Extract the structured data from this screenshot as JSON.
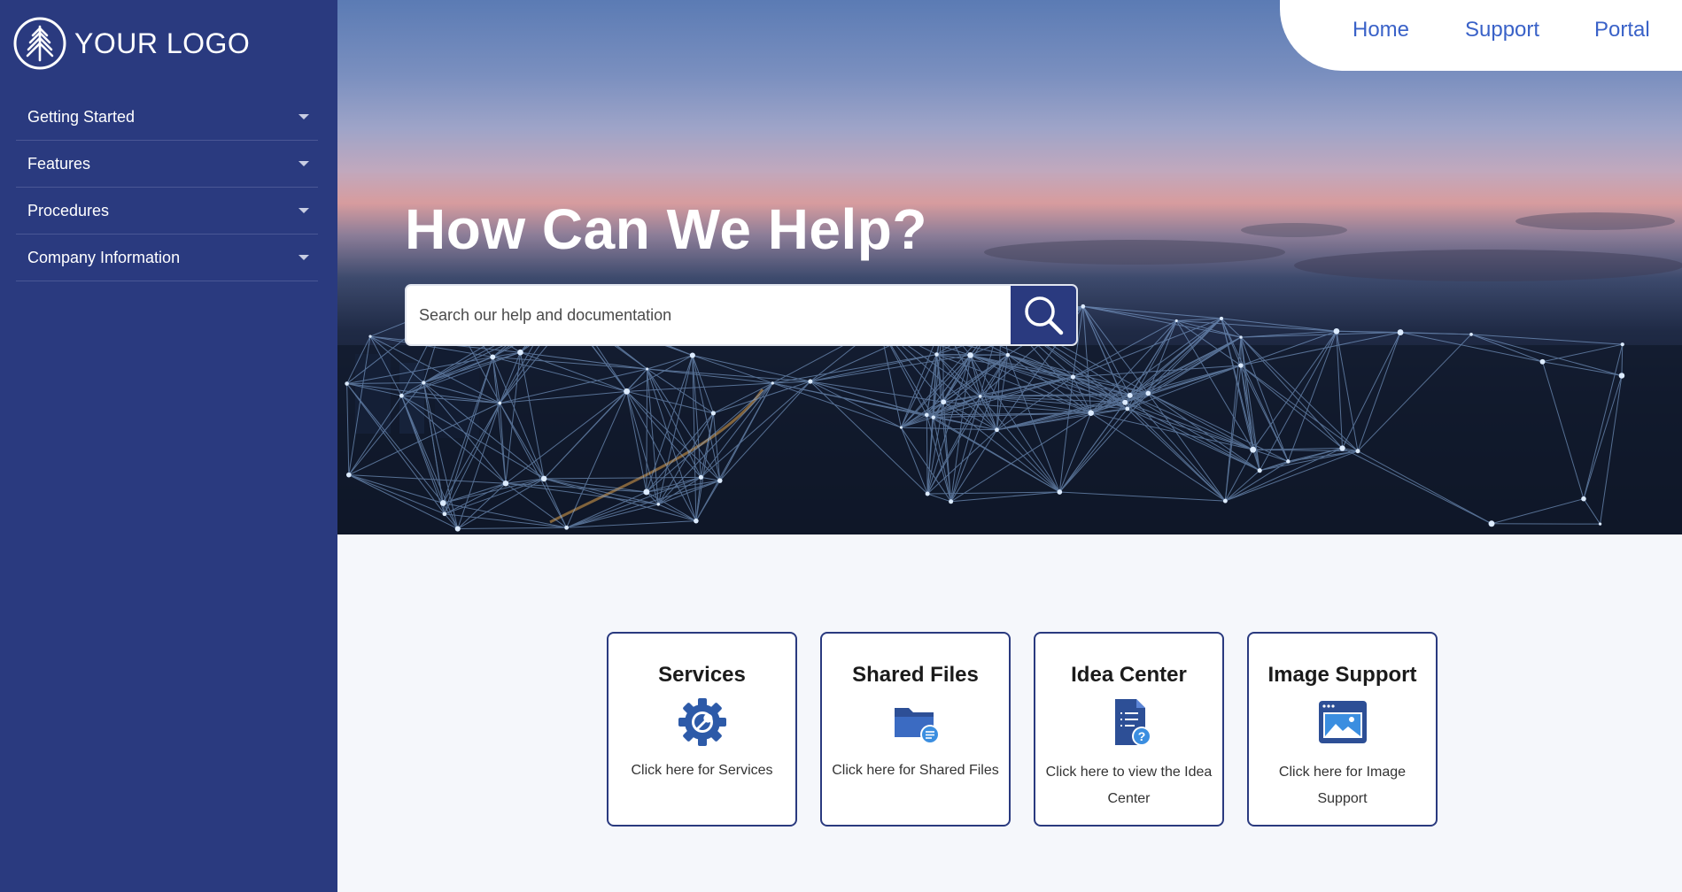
{
  "brand": {
    "logo_text": "YOUR LOGO"
  },
  "sidebar": {
    "items": [
      {
        "label": "Getting Started"
      },
      {
        "label": "Features"
      },
      {
        "label": "Procedures"
      },
      {
        "label": "Company Information"
      }
    ]
  },
  "topnav": {
    "home": "Home",
    "support": "Support",
    "portal": "Portal"
  },
  "hero": {
    "title": "How Can We Help?",
    "search_placeholder": "Search our help and documentation"
  },
  "cards": [
    {
      "title": "Services",
      "description": "Click here for Services",
      "icon": "gear-wrench-icon"
    },
    {
      "title": "Shared Files",
      "description": "Click here for Shared Files",
      "icon": "folder-icon"
    },
    {
      "title": "Idea Center",
      "description": "Click here to view the Idea Center",
      "icon": "document-question-icon"
    },
    {
      "title": "Image Support",
      "description": "Click here for Image Support",
      "icon": "image-window-icon"
    }
  ],
  "colors": {
    "sidebar_bg": "#2a3a7f",
    "accent_blue": "#3a62c8",
    "icon_blue": "#2d5aa8",
    "page_bg": "#f5f7fb"
  }
}
